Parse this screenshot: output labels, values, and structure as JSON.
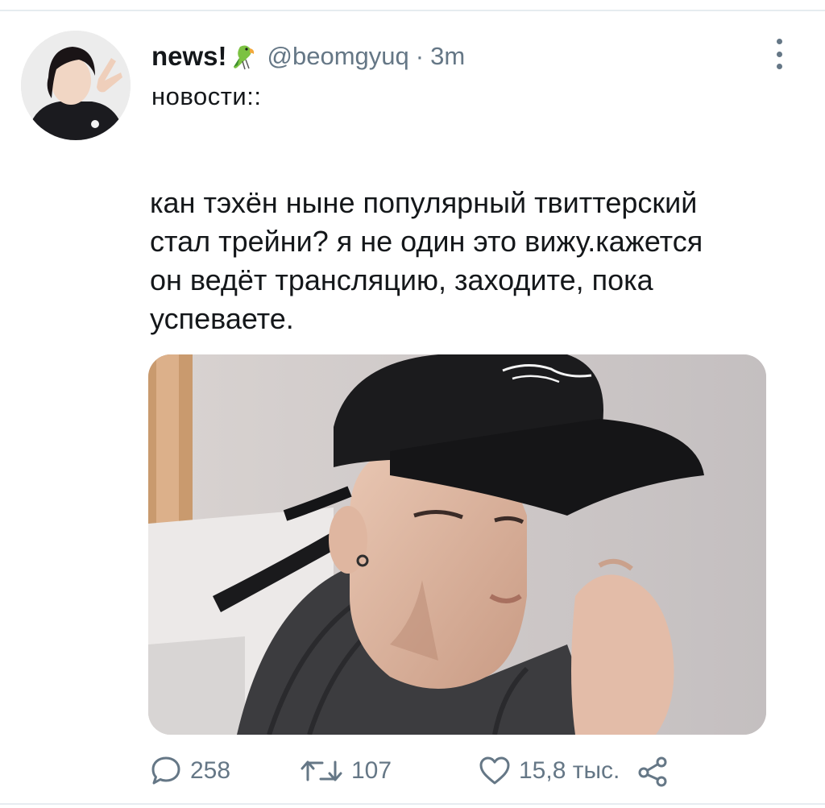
{
  "tweet": {
    "display_name": "news!",
    "badge_emoji_icon": "parrot-icon",
    "handle": "@beomgyuq",
    "separator": "·",
    "time": "3m",
    "bio_line": "новости::",
    "text": "кан тэхён ныне популярный твиттерский\nстал трейни? я не один это вижу.кажется\nон ведёт трансляцию, заходите, пока\nуспеваете."
  },
  "actions": {
    "reply_count": "258",
    "retweet_count": "107",
    "like_count": "15,8 тыс."
  },
  "icons": {
    "reply": "speech-bubble-icon",
    "retweet": "retweet-arrows-icon",
    "like": "heart-icon",
    "share": "share-nodes-icon",
    "more": "vertical-dots-icon"
  },
  "colors": {
    "text_primary": "#14171a",
    "text_secondary": "#657786",
    "divider": "#e6ecf0"
  }
}
